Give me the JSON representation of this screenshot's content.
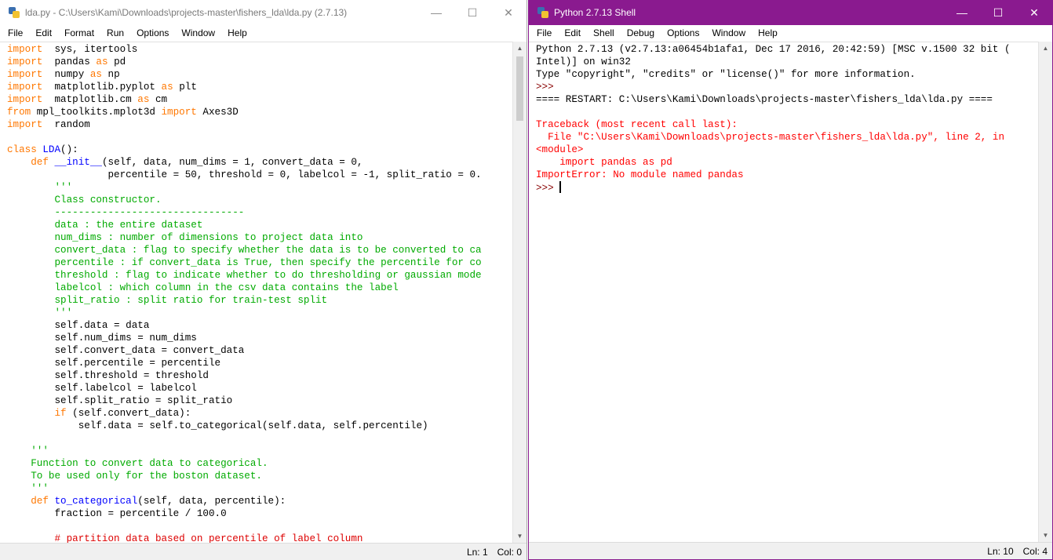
{
  "editor": {
    "title": "lda.py - C:\\Users\\Kami\\Downloads\\projects-master\\fishers_lda\\lda.py (2.7.13)",
    "menu": [
      "File",
      "Edit",
      "Format",
      "Run",
      "Options",
      "Window",
      "Help"
    ],
    "status": {
      "line": "Ln: 1",
      "col": "Col: 0"
    },
    "lines": [
      [
        [
          "kw",
          "import"
        ],
        [
          "",
          "  sys, itertools"
        ]
      ],
      [
        [
          "kw",
          "import"
        ],
        [
          "",
          "  pandas "
        ],
        [
          "kw",
          "as"
        ],
        [
          "",
          " pd"
        ]
      ],
      [
        [
          "kw",
          "import"
        ],
        [
          "",
          "  numpy "
        ],
        [
          "kw",
          "as"
        ],
        [
          "",
          " np"
        ]
      ],
      [
        [
          "kw",
          "import"
        ],
        [
          "",
          "  matplotlib.pyplot "
        ],
        [
          "kw",
          "as"
        ],
        [
          "",
          " plt"
        ]
      ],
      [
        [
          "kw",
          "import"
        ],
        [
          "",
          "  matplotlib.cm "
        ],
        [
          "kw",
          "as"
        ],
        [
          "",
          " cm"
        ]
      ],
      [
        [
          "kw",
          "from"
        ],
        [
          "",
          " mpl_toolkits.mplot3d "
        ],
        [
          "kw",
          "import"
        ],
        [
          "",
          " Axes3D"
        ]
      ],
      [
        [
          "kw",
          "import"
        ],
        [
          "",
          "  random"
        ]
      ],
      [
        [
          "",
          ""
        ]
      ],
      [
        [
          "kw",
          "class"
        ],
        [
          "",
          " "
        ],
        [
          "def",
          "LDA"
        ],
        [
          "",
          "():"
        ]
      ],
      [
        [
          "",
          "    "
        ],
        [
          "kw",
          "def"
        ],
        [
          "",
          " "
        ],
        [
          "def",
          "__init__"
        ],
        [
          "",
          "(self, data, num_dims = 1, convert_data = 0,"
        ]
      ],
      [
        [
          "",
          "                 percentile = 50, threshold = 0, labelcol = -1, split_ratio = 0."
        ]
      ],
      [
        [
          "",
          "        "
        ],
        [
          "str",
          "'''"
        ]
      ],
      [
        [
          "",
          "        "
        ],
        [
          "str",
          "Class constructor."
        ]
      ],
      [
        [
          "",
          "        "
        ],
        [
          "str",
          "--------------------------------"
        ]
      ],
      [
        [
          "",
          "        "
        ],
        [
          "str",
          "data : the entire dataset"
        ]
      ],
      [
        [
          "",
          "        "
        ],
        [
          "str",
          "num_dims : number of dimensions to project data into"
        ]
      ],
      [
        [
          "",
          "        "
        ],
        [
          "str",
          "convert_data : flag to specify whether the data is to be converted to ca"
        ]
      ],
      [
        [
          "",
          "        "
        ],
        [
          "str",
          "percentile : if convert_data is True, then specify the percentile for co"
        ]
      ],
      [
        [
          "",
          "        "
        ],
        [
          "str",
          "threshold : flag to indicate whether to do thresholding or gaussian mode"
        ]
      ],
      [
        [
          "",
          "        "
        ],
        [
          "str",
          "labelcol : which column in the csv data contains the label"
        ]
      ],
      [
        [
          "",
          "        "
        ],
        [
          "str",
          "split_ratio : split ratio for train-test split"
        ]
      ],
      [
        [
          "",
          "        "
        ],
        [
          "str",
          "'''"
        ]
      ],
      [
        [
          "",
          "        self.data = data"
        ]
      ],
      [
        [
          "",
          "        self.num_dims = num_dims"
        ]
      ],
      [
        [
          "",
          "        self.convert_data = convert_data"
        ]
      ],
      [
        [
          "",
          "        self.percentile = percentile"
        ]
      ],
      [
        [
          "",
          "        self.threshold = threshold"
        ]
      ],
      [
        [
          "",
          "        self.labelcol = labelcol"
        ]
      ],
      [
        [
          "",
          "        self.split_ratio = split_ratio"
        ]
      ],
      [
        [
          "",
          "        "
        ],
        [
          "kw",
          "if"
        ],
        [
          "",
          " (self.convert_data):"
        ]
      ],
      [
        [
          "",
          "            self.data = self.to_categorical(self.data, self.percentile)"
        ]
      ],
      [
        [
          "",
          ""
        ]
      ],
      [
        [
          "",
          "    "
        ],
        [
          "str",
          "'''"
        ]
      ],
      [
        [
          "",
          "    "
        ],
        [
          "str",
          "Function to convert data to categorical."
        ]
      ],
      [
        [
          "",
          "    "
        ],
        [
          "str",
          "To be used only for the boston dataset."
        ]
      ],
      [
        [
          "",
          "    "
        ],
        [
          "str",
          "'''"
        ]
      ],
      [
        [
          "",
          "    "
        ],
        [
          "kw",
          "def"
        ],
        [
          "",
          " "
        ],
        [
          "def",
          "to_categorical"
        ],
        [
          "",
          "(self, data, percentile):"
        ]
      ],
      [
        [
          "",
          "        fraction = percentile / 100.0"
        ]
      ],
      [
        [
          "",
          ""
        ]
      ],
      [
        [
          "",
          "        "
        ],
        [
          "com",
          "# partition data based on percentile of label column"
        ]
      ]
    ]
  },
  "shell": {
    "title": "Python 2.7.13 Shell",
    "menu": [
      "File",
      "Edit",
      "Shell",
      "Debug",
      "Options",
      "Window",
      "Help"
    ],
    "status": {
      "line": "Ln: 10",
      "col": "Col: 4"
    },
    "lines": [
      [
        [
          "",
          "Python 2.7.13 (v2.7.13:a06454b1afa1, Dec 17 2016, 20:42:59) [MSC v.1500 32 bit ("
        ]
      ],
      [
        [
          "",
          "Intel)] on win32"
        ]
      ],
      [
        [
          "",
          "Type \"copyright\", \"credits\" or \"license()\" for more information."
        ]
      ],
      [
        [
          "prompt",
          ">>>"
        ]
      ],
      [
        [
          "",
          "==== RESTART: C:\\Users\\Kami\\Downloads\\projects-master\\fishers_lda\\lda.py ===="
        ]
      ],
      [
        [
          "",
          ""
        ]
      ],
      [
        [
          "err",
          "Traceback (most recent call last):"
        ]
      ],
      [
        [
          "err",
          "  File \"C:\\Users\\Kami\\Downloads\\projects-master\\fishers_lda\\lda.py\", line 2, in"
        ]
      ],
      [
        [
          "err",
          "<module>"
        ]
      ],
      [
        [
          "err",
          "    import pandas as pd"
        ]
      ],
      [
        [
          "err",
          "ImportError: No module named pandas"
        ]
      ],
      [
        [
          "prompt",
          ">>> "
        ]
      ]
    ]
  }
}
